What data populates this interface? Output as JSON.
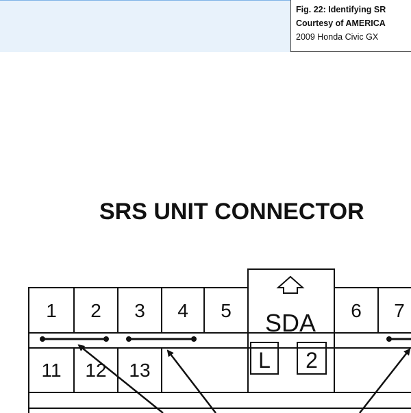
{
  "caption": {
    "line1": "Fig. 22: Identifying SR",
    "line2": "Courtesy of AMERICA",
    "line3": "2009 Honda Civic GX"
  },
  "diagram": {
    "title": "SRS UNIT CONNECTOR",
    "pins_top": [
      "1",
      "2",
      "3",
      "4",
      "5",
      "6",
      "7"
    ],
    "pins_bottom": [
      "11",
      "12",
      "13"
    ],
    "sda_label": "SDA",
    "l_label": "L",
    "two_label": "2"
  }
}
